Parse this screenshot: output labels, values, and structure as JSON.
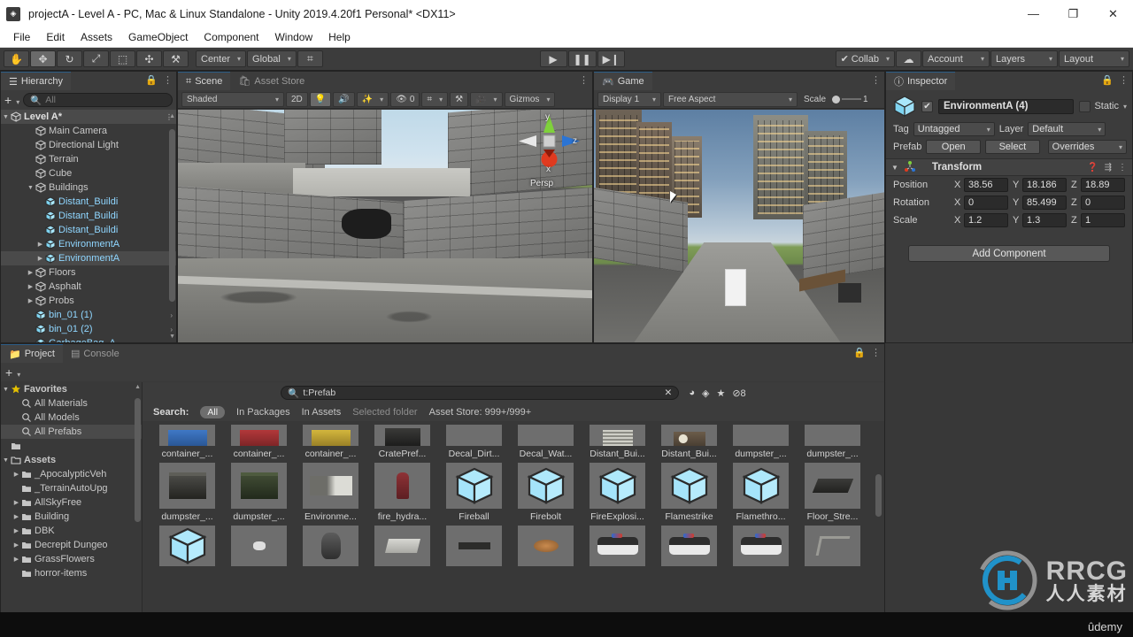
{
  "window": {
    "title": "projectA - Level A - PC, Mac & Linux Standalone - Unity 2019.4.20f1 Personal* <DX11>",
    "app_icon": "unity-icon",
    "minimize": "—",
    "maximize": "❐",
    "close": "✕"
  },
  "menubar": {
    "items": [
      "File",
      "Edit",
      "Assets",
      "GameObject",
      "Component",
      "Window",
      "Help"
    ]
  },
  "toolbar": {
    "tools": [
      {
        "name": "hand-tool",
        "glyph": "✋",
        "active": false
      },
      {
        "name": "move-tool",
        "glyph": "✥",
        "active": true
      },
      {
        "name": "rotate-tool",
        "glyph": "↻",
        "active": false
      },
      {
        "name": "scale-tool",
        "glyph": "⤢",
        "active": false
      },
      {
        "name": "rect-tool",
        "glyph": "⬚",
        "active": false
      },
      {
        "name": "transform-tool",
        "glyph": "✣",
        "active": false
      },
      {
        "name": "custom-tool",
        "glyph": "⚒",
        "active": false
      }
    ],
    "pivot_mode": "Center",
    "pivot_rotation": "Global",
    "snap_label": "",
    "playback": [
      {
        "name": "play-button",
        "glyph": "▶"
      },
      {
        "name": "pause-button",
        "glyph": "❚❚"
      },
      {
        "name": "step-button",
        "glyph": "▶❙"
      }
    ],
    "collab": "Collab",
    "cloud_icon": "cloud-icon",
    "account": "Account",
    "layers": "Layers",
    "layout": "Layout"
  },
  "hierarchy": {
    "tab": "Hierarchy",
    "search_placeholder": "All",
    "add_label": "+",
    "scene_name": "Level A*",
    "items": [
      {
        "label": "Main Camera",
        "depth": 2,
        "prefab": false,
        "expandable": false
      },
      {
        "label": "Directional Light",
        "depth": 2,
        "prefab": false,
        "expandable": false
      },
      {
        "label": "Terrain",
        "depth": 2,
        "prefab": false,
        "expandable": false
      },
      {
        "label": "Cube",
        "depth": 2,
        "prefab": false,
        "expandable": false
      },
      {
        "label": "Buildings",
        "depth": 2,
        "prefab": false,
        "expandable": true,
        "expanded": true
      },
      {
        "label": "Distant_Buildi",
        "depth": 3,
        "prefab": true,
        "expandable": false,
        "chevron": true
      },
      {
        "label": "Distant_Buildi",
        "depth": 3,
        "prefab": true,
        "expandable": false,
        "chevron": true
      },
      {
        "label": "Distant_Buildi",
        "depth": 3,
        "prefab": true,
        "expandable": false,
        "chevron": true
      },
      {
        "label": "EnvironmentA",
        "depth": 3,
        "prefab": true,
        "expandable": true,
        "chevron": true
      },
      {
        "label": "EnvironmentA",
        "depth": 3,
        "prefab": true,
        "expandable": true,
        "chevron": true,
        "selected": true
      },
      {
        "label": "Floors",
        "depth": 2,
        "prefab": false,
        "expandable": true
      },
      {
        "label": "Asphalt",
        "depth": 2,
        "prefab": false,
        "expandable": true
      },
      {
        "label": "Probs",
        "depth": 2,
        "prefab": false,
        "expandable": true
      },
      {
        "label": "bin_01 (1)",
        "depth": 2,
        "prefab": true,
        "expandable": false,
        "chevron": true
      },
      {
        "label": "bin_01 (2)",
        "depth": 2,
        "prefab": true,
        "expandable": false,
        "chevron": true
      },
      {
        "label": "GarbageBag_A",
        "depth": 2,
        "prefab": true,
        "expandable": false,
        "chevron": true
      }
    ]
  },
  "scene_view": {
    "tabs": [
      {
        "label": "Scene",
        "icon": "scene-grid-icon",
        "active": true
      },
      {
        "label": "Asset Store",
        "icon": "asset-store-icon",
        "active": false
      }
    ],
    "draw_mode": "Shaded",
    "mode_2d": "2D",
    "lighting_icon": "lightbulb-icon",
    "audio_icon": "speaker-icon",
    "fx_icon": "effects-icon",
    "hidden_count": "0",
    "grid_icon": "grid-visibility-icon",
    "component_tools_icon": "component-tools-icon",
    "camera_icon": "scene-camera-icon",
    "gizmos": "Gizmos",
    "gizmo_axes": {
      "x": "x",
      "y": "y",
      "z": "z",
      "mode": "Persp"
    }
  },
  "game_view": {
    "tab": "Game",
    "display": "Display 1",
    "aspect": "Free Aspect",
    "scale_label": "Scale",
    "scale_value": "1"
  },
  "inspector": {
    "tab": "Inspector",
    "object_name": "EnvironmentA (4)",
    "enabled": true,
    "static_label": "Static",
    "tag_label": "Tag",
    "tag_value": "Untagged",
    "layer_label": "Layer",
    "layer_value": "Default",
    "prefab_label": "Prefab",
    "prefab_open": "Open",
    "prefab_select": "Select",
    "prefab_overrides": "Overrides",
    "transform": {
      "title": "Transform",
      "rows": [
        {
          "label": "Position",
          "x": "38.56",
          "y": "18.186",
          "z": "18.89"
        },
        {
          "label": "Rotation",
          "x": "0",
          "y": "85.499",
          "z": "0"
        },
        {
          "label": "Scale",
          "x": "1.2",
          "y": "1.3",
          "z": "1"
        }
      ],
      "axes": [
        "X",
        "Y",
        "Z"
      ]
    },
    "add_component": "Add Component"
  },
  "project": {
    "tabs": [
      {
        "label": "Project",
        "icon": "folder-icon",
        "active": true
      },
      {
        "label": "Console",
        "icon": "console-icon",
        "active": false
      }
    ],
    "add_label": "+",
    "search_value": "t:Prefab",
    "search_icon": "search-icon",
    "clear_icon": "clear-icon",
    "filter_icons": [
      {
        "name": "filter-by-type-icon",
        "glyph": "◕"
      },
      {
        "name": "filter-by-label-icon",
        "glyph": "◈"
      },
      {
        "name": "favorite-filter-icon",
        "glyph": "★"
      },
      {
        "name": "hidden-packages-icon",
        "glyph": "⊘",
        "count": "8"
      }
    ],
    "filterbar": {
      "search_label": "Search:",
      "scopes": [
        "All",
        "In Packages",
        "In Assets",
        "Selected folder"
      ],
      "active_scope": "All",
      "asset_store": "Asset Store: 999+/999+"
    },
    "tree": {
      "favorites": {
        "label": "Favorites",
        "items": [
          "All Materials",
          "All Models",
          "All Prefabs"
        ],
        "selected": "All Prefabs"
      },
      "assets": {
        "label": "Assets",
        "items": [
          {
            "label": "_ApocalypticVeh",
            "expandable": true
          },
          {
            "label": "_TerrainAutoUpg",
            "expandable": false
          },
          {
            "label": "AllSkyFree",
            "expandable": true
          },
          {
            "label": "Building",
            "expandable": true
          },
          {
            "label": "DBK",
            "expandable": true
          },
          {
            "label": "Decrepit Dungeo",
            "expandable": true
          },
          {
            "label": "GrassFlowers",
            "expandable": true
          },
          {
            "label": "horror-items",
            "expandable": false
          }
        ]
      }
    },
    "grid_rows": [
      [
        {
          "label": "container_...",
          "thumb": "container-blue"
        },
        {
          "label": "container_...",
          "thumb": "container-red"
        },
        {
          "label": "container_...",
          "thumb": "container-yellow"
        },
        {
          "label": "CratePref...",
          "thumb": "crate"
        },
        {
          "label": "Decal_Dirt...",
          "thumb": "blank"
        },
        {
          "label": "Decal_Wat...",
          "thumb": "blank"
        },
        {
          "label": "Distant_Bui...",
          "thumb": "building"
        },
        {
          "label": "Distant_Bui...",
          "thumb": "building-rubble"
        },
        {
          "label": "dumpster_...",
          "thumb": "blank"
        },
        {
          "label": "dumpster_...",
          "thumb": "blank"
        }
      ],
      [
        {
          "label": "dumpster_...",
          "thumb": "dumpster-dark"
        },
        {
          "label": "dumpster_...",
          "thumb": "dumpster-green"
        },
        {
          "label": "Environme...",
          "thumb": "environment"
        },
        {
          "label": "fire_hydra...",
          "thumb": "hydrant"
        },
        {
          "label": "Fireball",
          "thumb": "prefab-cube"
        },
        {
          "label": "Firebolt",
          "thumb": "prefab-cube"
        },
        {
          "label": "FireExplosi...",
          "thumb": "prefab-cube"
        },
        {
          "label": "Flamestrike",
          "thumb": "prefab-cube"
        },
        {
          "label": "Flamethro...",
          "thumb": "prefab-cube"
        },
        {
          "label": "Floor_Stre...",
          "thumb": "floor-slab"
        }
      ],
      [
        {
          "label": "",
          "thumb": "prefab-cube"
        },
        {
          "label": "",
          "thumb": "small-debris"
        },
        {
          "label": "",
          "thumb": "garbage-bag"
        },
        {
          "label": "",
          "thumb": "pale-sheet"
        },
        {
          "label": "",
          "thumb": "gun"
        },
        {
          "label": "",
          "thumb": "orange-blob"
        },
        {
          "label": "",
          "thumb": "police-car"
        },
        {
          "label": "",
          "thumb": "police-car"
        },
        {
          "label": "",
          "thumb": "police-car"
        },
        {
          "label": "",
          "thumb": "lamp-post"
        }
      ]
    ]
  },
  "watermark": {
    "brand": "RRCG",
    "subtitle": "人人素材",
    "platform": "ûdemy"
  },
  "colors": {
    "panel_bg": "#393939",
    "toolbar_bg": "#3c3c3c",
    "accent_blue": "#8fd6ff",
    "selection": "#4a4a4a",
    "text": "#c8c8c8"
  }
}
